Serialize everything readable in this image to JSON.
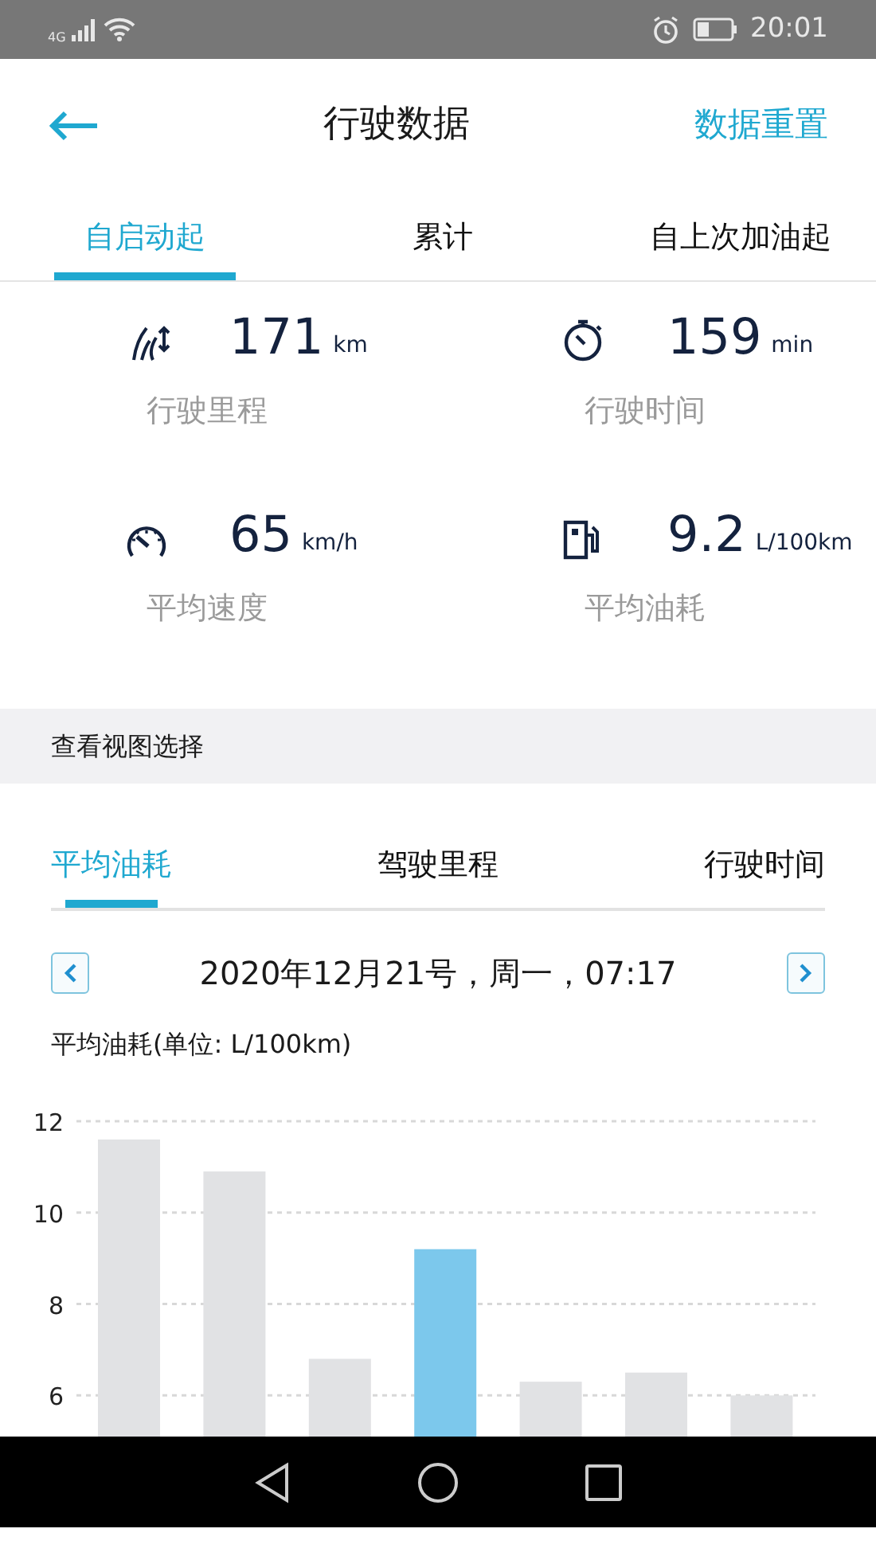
{
  "status_bar": {
    "network": "4G",
    "time": "20:01"
  },
  "header": {
    "title": "行驶数据",
    "action": "数据重置"
  },
  "period_tabs": [
    {
      "label": "自启动起",
      "selected": true
    },
    {
      "label": "累计",
      "selected": false
    },
    {
      "label": "自上次加油起",
      "selected": false
    }
  ],
  "stats": [
    {
      "kind": "distance",
      "value": "171",
      "unit": "km",
      "label": "行驶里程"
    },
    {
      "kind": "time",
      "value": "159",
      "unit": "min",
      "label": "行驶时间"
    },
    {
      "kind": "speed",
      "value": "65",
      "unit": "km/h",
      "label": "平均速度"
    },
    {
      "kind": "fuel",
      "value": "9.2",
      "unit": "L/100km",
      "label": "平均油耗"
    }
  ],
  "view_section": {
    "title": "查看视图选择"
  },
  "view_tabs": [
    {
      "label": "平均油耗",
      "selected": true
    },
    {
      "label": "驾驶里程",
      "selected": false
    },
    {
      "label": "行驶时间",
      "selected": false
    }
  ],
  "date": "2020年12月21号，周一，07:17",
  "chart_label": "平均油耗(单位: L/100km)",
  "chart_data": {
    "type": "bar",
    "grid": true,
    "ylim": [
      5.1,
      12
    ],
    "yticks": [
      6,
      8,
      10,
      12
    ],
    "series": [
      {
        "color": "#e1e2e4",
        "values": [
          11.6,
          10.9,
          6.8,
          null,
          6.3,
          6.5,
          6.0
        ]
      },
      {
        "color": "#7cc8ec",
        "values": [
          null,
          null,
          null,
          9.2,
          null,
          null,
          null
        ]
      }
    ]
  }
}
